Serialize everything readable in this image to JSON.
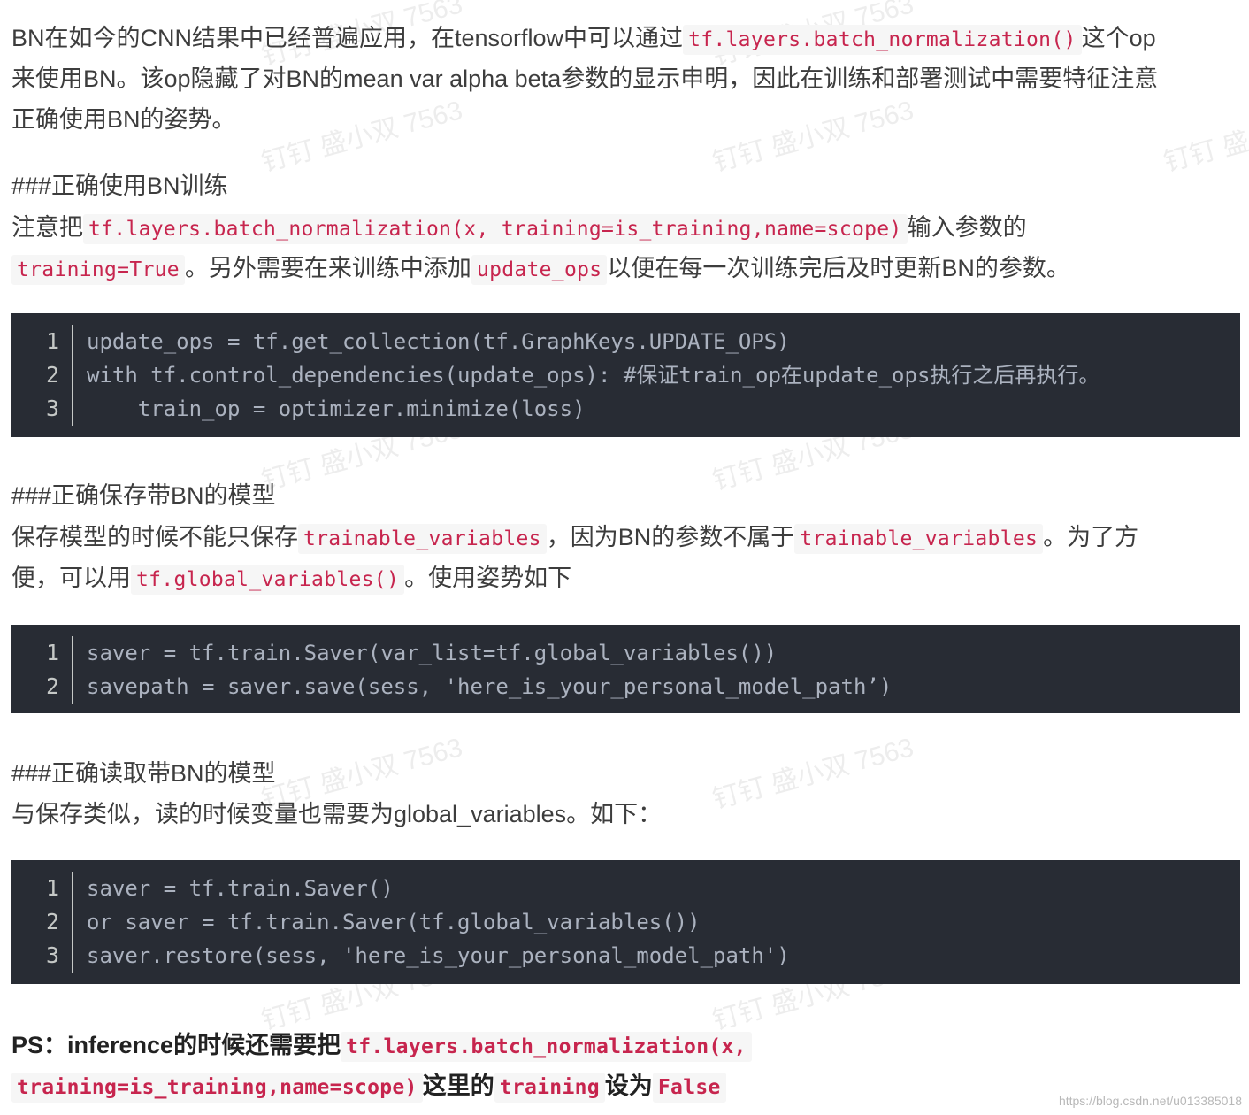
{
  "intro": {
    "l1a": "BN在如今的CNN结果中已经普遍应用，在tensorflow中可以通过",
    "l1code": "tf.layers.batch_normalization()",
    "l1b": "这个op",
    "l2": "来使用BN。该op隐藏了对BN的mean var alpha beta参数的显示申明，因此在训练和部署测试中需要特征注意",
    "l3": "正确使用BN的姿势。"
  },
  "section_train": {
    "heading": "###正确使用BN训练",
    "p1a": "注意把",
    "p1code": "tf.layers.batch_normalization(x, training=is_training,name=scope)",
    "p1b": "输入参数的",
    "p2code1": "training=True",
    "p2a": "。另外需要在来训练中添加",
    "p2code2": "update_ops",
    "p2b": "以便在每一次训练完后及时更新BN的参数。",
    "code": [
      {
        "n": "1",
        "t": "update_ops = tf.get_collection(tf.GraphKeys.UPDATE_OPS)"
      },
      {
        "n": "2",
        "t": "with tf.control_dependencies(update_ops): #保证train_op在update_ops执行之后再执行。"
      },
      {
        "n": "3",
        "t": "    train_op = optimizer.minimize(loss)"
      }
    ]
  },
  "section_save": {
    "heading": "###正确保存带BN的模型",
    "p1a": "保存模型的时候不能只保存",
    "p1code1": "trainable_variables",
    "p1b": "，因为BN的参数不属于",
    "p1code2": "trainable_variables",
    "p1c": "。为了方",
    "p2a": "便，可以用",
    "p2code": "tf.global_variables()",
    "p2b": "。使用姿势如下",
    "code": [
      {
        "n": "1",
        "t": "saver = tf.train.Saver(var_list=tf.global_variables())"
      },
      {
        "n": "2",
        "t": "savepath = saver.save(sess, 'here_is_your_personal_model_path’)"
      }
    ]
  },
  "section_load": {
    "heading": "###正确读取带BN的模型",
    "p1": "与保存类似，读的时候变量也需要为global_variables。如下：",
    "code": [
      {
        "n": "1",
        "t": "saver = tf.train.Saver()"
      },
      {
        "n": "2",
        "t": "or saver = tf.train.Saver(tf.global_variables())"
      },
      {
        "n": "3",
        "t": "saver.restore(sess, 'here_is_your_personal_model_path')"
      }
    ]
  },
  "ps": {
    "l1a": "PS：inference的时候还需要把",
    "l1code": "tf.layers.batch_normalization(x,",
    "l2code1": "training=is_training,name=scope)",
    "l2a": "这里的",
    "l2code2": "training",
    "l2b": "设为",
    "l2code3": "False"
  },
  "watermark": "钉钉 盛小双 7563",
  "footer": "https://blog.csdn.net/u013385018"
}
